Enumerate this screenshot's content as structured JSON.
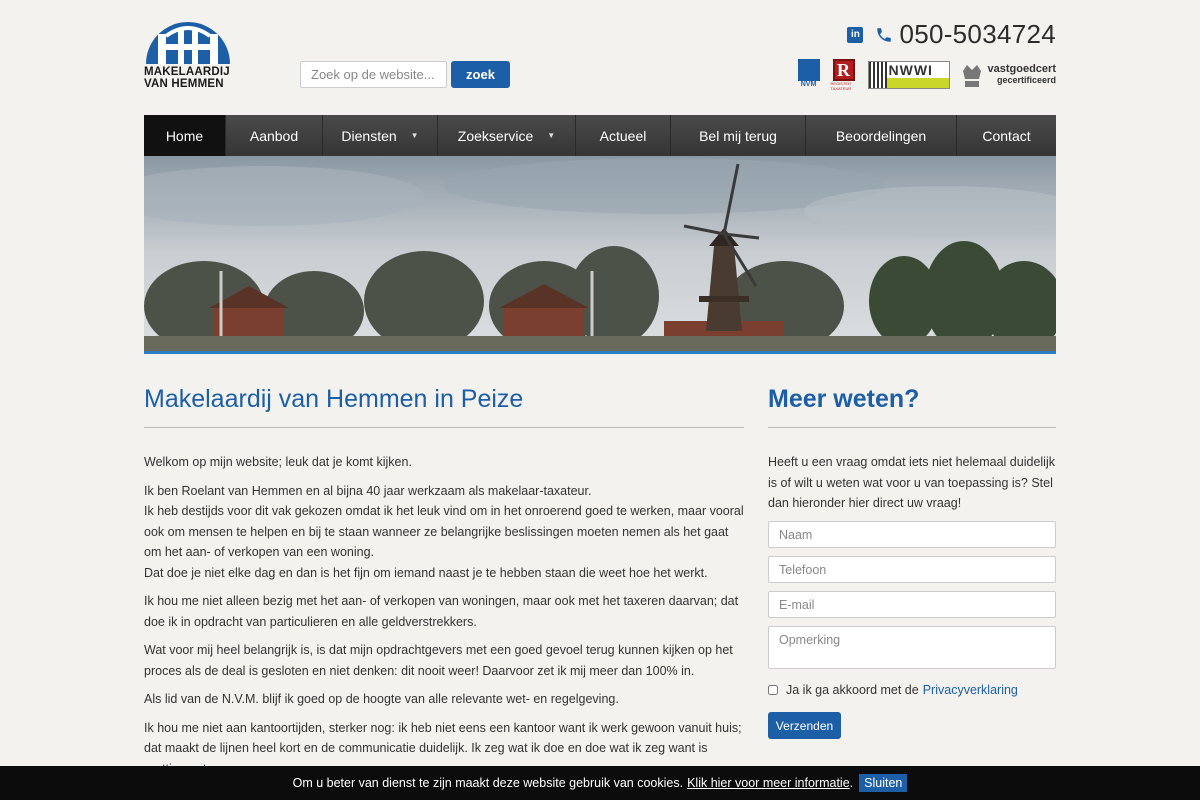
{
  "logo": {
    "line1": "MAKELAARDIJ",
    "line2": "VAN HEMMEN",
    "brand_color": "#1d5fa6"
  },
  "search": {
    "placeholder": "Zoek op de website...",
    "button_label": "zoek"
  },
  "contact": {
    "linkedin_icon": "linkedin-icon",
    "linkedin_label": "in",
    "phone_icon": "phone-icon",
    "phone": "050-5034724"
  },
  "badges": {
    "nvm": "NVM",
    "rt_letter": "R",
    "rt_sub": "REGISTER TAXATEUR",
    "nwwi": "NWWI",
    "vgc_main": "vastgoedcert",
    "vgc_sub": "gecertificeerd"
  },
  "nav": {
    "items": [
      {
        "label": "Home",
        "active": true
      },
      {
        "label": "Aanbod"
      },
      {
        "label": "Diensten",
        "dropdown": true
      },
      {
        "label": "Zoekservice",
        "dropdown": true
      },
      {
        "label": "Actueel"
      },
      {
        "label": "Bel mij terug"
      },
      {
        "label": "Beoordelingen"
      },
      {
        "label": "Contact"
      }
    ],
    "caret": "▼"
  },
  "main": {
    "title": "Makelaardij van Hemmen in Peize",
    "p1": "Welkom op mijn website; leuk dat je komt kijken.",
    "p2a": "Ik ben Roelant van Hemmen en al bijna 40 jaar werkzaam als makelaar-taxateur.",
    "p2b": "Ik heb destijds voor dit vak gekozen omdat ik het leuk vind om in het onroerend goed te werken, maar vooral ook om mensen te helpen en bij te staan wanneer ze belangrijke beslissingen moeten nemen als het gaat om het aan- of verkopen van een woning.",
    "p2c": "Dat doe je niet elke dag en dan is het fijn om iemand naast je te hebben staan die weet hoe het werkt.",
    "p3": "Ik hou me niet alleen bezig met het aan- of verkopen van woningen, maar ook met het taxeren daarvan; dat doe ik in opdracht van particulieren en alle geldverstrekkers.",
    "p4": "Wat voor mij heel belangrijk is, is dat mijn opdrachtgevers met een goed gevoel terug kunnen kijken op het proces als de deal is gesloten en niet denken: dit nooit weer! Daarvoor zet ik mij meer dan 100% in.",
    "p5": "Als lid van de N.V.M. blijf ik goed op de hoogte van alle relevante wet- en regelgeving.",
    "p6": "Ik hou me niet aan kantoortijden, sterker nog: ik heb niet eens een kantoor want ik werk gewoon vanuit huis; dat maakt de lijnen heel kort en de communicatie duidelijk. Ik zeg wat ik doe en doe wat ik zeg want is prettig om te"
  },
  "sidebar": {
    "title": "Meer weten?",
    "intro": "Heeft u een vraag omdat iets niet helemaal duidelijk is of wilt u weten wat voor u van toepassing is? Stel dan hieronder hier direct uw vraag!",
    "name_placeholder": "Naam",
    "phone_placeholder": "Telefoon",
    "email_placeholder": "E-mail",
    "remark_placeholder": "Opmerking",
    "agree_text": "Ja ik ga akkoord met de",
    "agree_link": "Privacyverklaring",
    "submit_label": "Verzenden"
  },
  "cookie": {
    "text": "Om u beter van dienst te zijn maakt deze website gebruik van cookies.",
    "link": "Klik hier voor meer informatie",
    "suffix": ".",
    "button": "Sluiten"
  }
}
